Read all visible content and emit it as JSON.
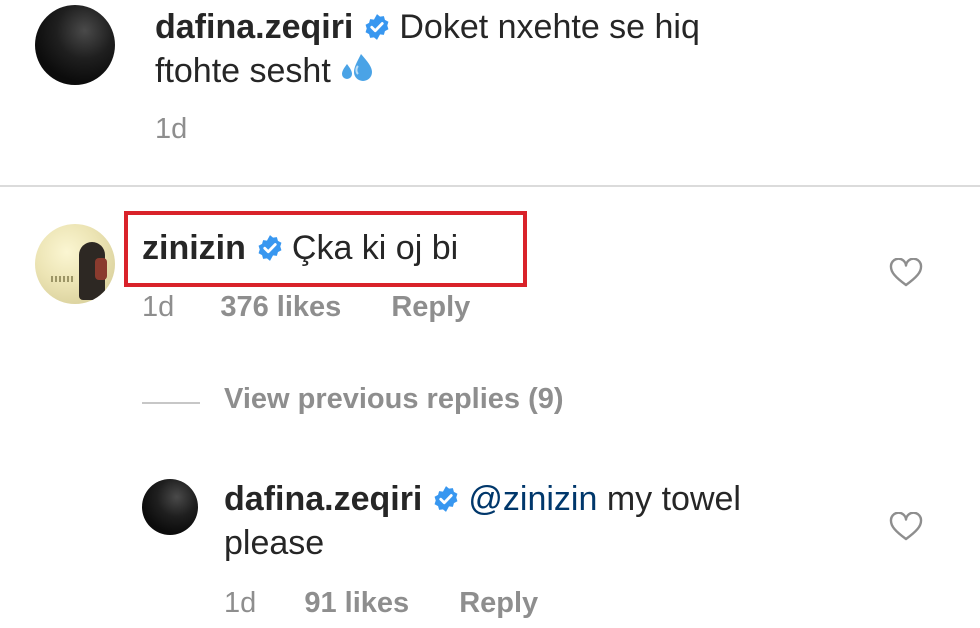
{
  "comment1": {
    "username": "dafina.zeqiri",
    "text_line1": "Doket nxehte se hiq",
    "text_line2": "ftohte sesht",
    "emoji": "sweat-droplets",
    "time": "1d"
  },
  "comment2": {
    "username": "zinizin",
    "text": "Çka ki oj bi",
    "time": "1d",
    "likes": "376 likes",
    "reply": "Reply",
    "highlight_color": "#d9222a"
  },
  "view_previous": "View previous replies (9)",
  "reply1": {
    "username": "dafina.zeqiri",
    "mention": "@zinizin",
    "text_line1": " my towel",
    "text_line2": "please",
    "time": "1d",
    "likes": "91 likes",
    "reply": "Reply"
  },
  "colors": {
    "verified": "#3897f0",
    "meta": "#8e8e8e",
    "mention": "#00376b"
  }
}
